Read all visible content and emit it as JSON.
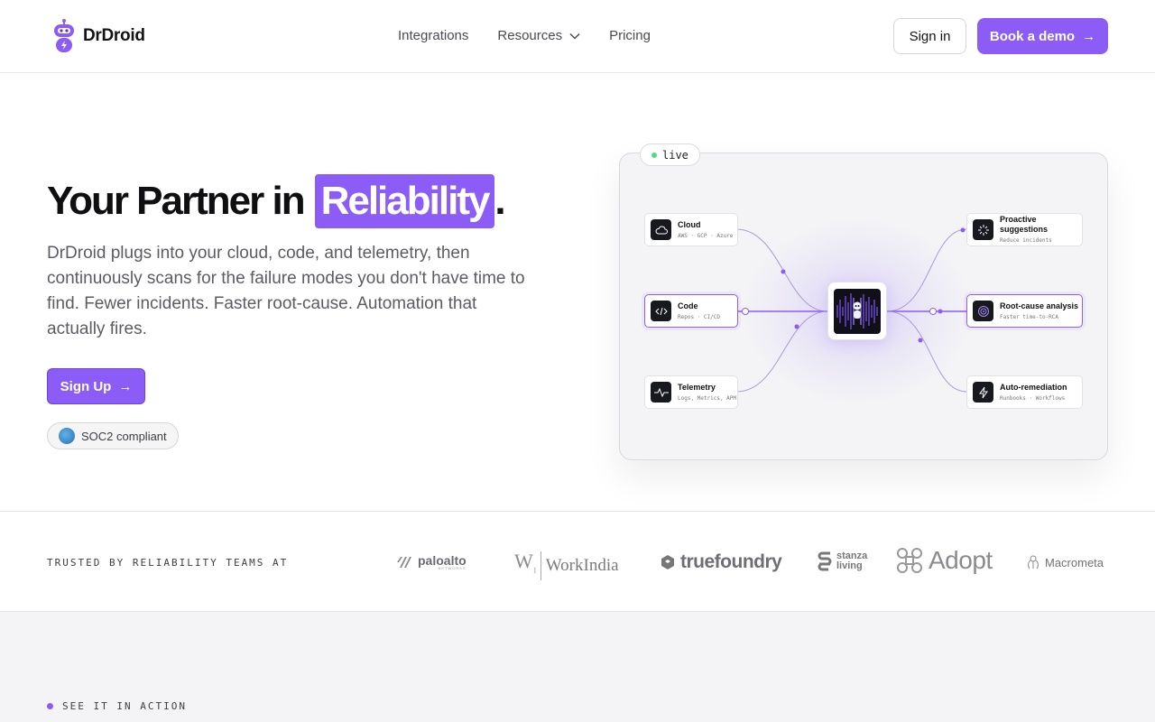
{
  "header": {
    "logo_text": "DrDroid",
    "nav": [
      {
        "label": "Integrations"
      },
      {
        "label": "Resources",
        "icon": "chevron-down-icon"
      },
      {
        "label": "Pricing"
      }
    ],
    "signin_label": "Sign in",
    "demo_label": "Book a demo",
    "demo_arrow": "→"
  },
  "hero": {
    "title_prefix": "Your Partner in",
    "title_highlight": "Reliability",
    "title_suffix": ".",
    "description": "DrDroid plugs into your cloud, code, and telemetry, then continuously scans for the failure modes you don't have time to find. Fewer incidents. Faster root-cause. Automation that actually fires.",
    "signup_label": "Sign Up",
    "signup_arrow": "→",
    "soc2_label": "SOC2 compliant"
  },
  "diagram": {
    "live_label": "live",
    "inputs": [
      {
        "title": "Cloud",
        "sub": "AWS · GCP · Azure",
        "icon": "cloud-icon"
      },
      {
        "title": "Code",
        "sub": "Repos · CI/CD",
        "icon": "code-icon"
      },
      {
        "title": "Telemetry",
        "sub": "Logs, Metrics, APM",
        "icon": "pulse-icon"
      }
    ],
    "outputs": [
      {
        "title": "Proactive suggestions",
        "sub": "Reduce incidents",
        "icon": "sparkle-icon"
      },
      {
        "title": "Root-cause analysis",
        "sub": "Faster time-to-RCA",
        "icon": "target-icon"
      },
      {
        "title": "Auto-remediation",
        "sub": "Runbooks · Workflows",
        "icon": "bolt-icon"
      }
    ],
    "accent": "#8b5cf6"
  },
  "trusted": {
    "label": "TRUSTED BY RELIABILITY TEAMS AT",
    "logos": [
      "paloalto",
      "WorkIndia",
      "truefoundry",
      "stanza living",
      "Adopt",
      "Macrometa"
    ],
    "paloalto_sub": "NETWORKS"
  },
  "section": {
    "label": "SEE IT IN ACTION"
  }
}
